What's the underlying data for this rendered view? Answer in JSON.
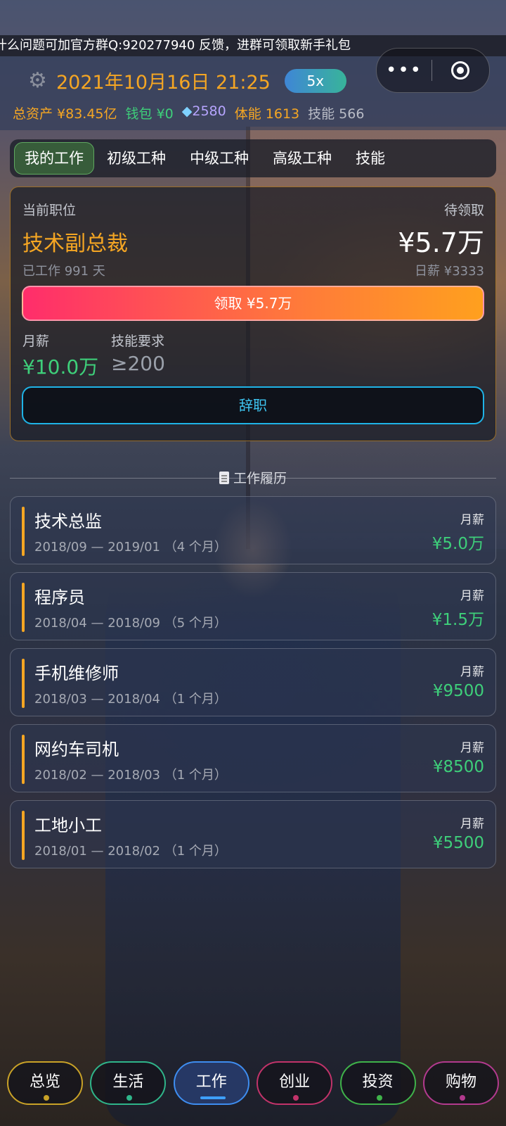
{
  "marquee": "什么问题可加官方群Q:920277940 反馈，进群可领取新手礼包",
  "header": {
    "gear_icon": "gear-icon",
    "datetime": "2021年10月16日 21:25",
    "speed": "5x",
    "capsule_menu": "•••"
  },
  "stats": {
    "assets": "总资产 ¥83.45亿",
    "wallet": "钱包 ¥0",
    "gems": "2580",
    "stamina": "体能 1613",
    "skill": "技能 566"
  },
  "tabs": [
    "我的工作",
    "初级工种",
    "中级工种",
    "高级工种",
    "技能"
  ],
  "current_job": {
    "label": "当前职位",
    "title": "技术副总裁",
    "worked": "已工作 991 天",
    "pending_label": "待领取",
    "pending_amount": "¥5.7万",
    "daily": "日薪 ¥3333",
    "claim_button": "领取 ¥5.7万",
    "salary_label": "月薪",
    "salary_value": "¥10.0万",
    "requirement_label": "技能要求",
    "requirement_value": "≥200",
    "resign_button": "辞职"
  },
  "history": {
    "title": "工作履历",
    "salary_label": "月薪",
    "items": [
      {
        "name": "技术总监",
        "period": "2018/09 — 2019/01 （4 个月）",
        "salary": "¥5.0万"
      },
      {
        "name": "程序员",
        "period": "2018/04 — 2018/09 （5 个月）",
        "salary": "¥1.5万"
      },
      {
        "name": "手机维修师",
        "period": "2018/03 — 2018/04 （1 个月）",
        "salary": "¥9500"
      },
      {
        "name": "网约车司机",
        "period": "2018/02 — 2018/03 （1 个月）",
        "salary": "¥8500"
      },
      {
        "name": "工地小工",
        "period": "2018/01 — 2018/02 （1 个月）",
        "salary": "¥5500"
      }
    ]
  },
  "bottom_nav": [
    {
      "label": "总览",
      "color": "#c9a227"
    },
    {
      "label": "生活",
      "color": "#2fb58a"
    },
    {
      "label": "工作",
      "color": "#3e8df0",
      "active": true
    },
    {
      "label": "创业",
      "color": "#c2336a"
    },
    {
      "label": "投资",
      "color": "#3fb24a"
    },
    {
      "label": "购物",
      "color": "#b23a8e"
    }
  ]
}
